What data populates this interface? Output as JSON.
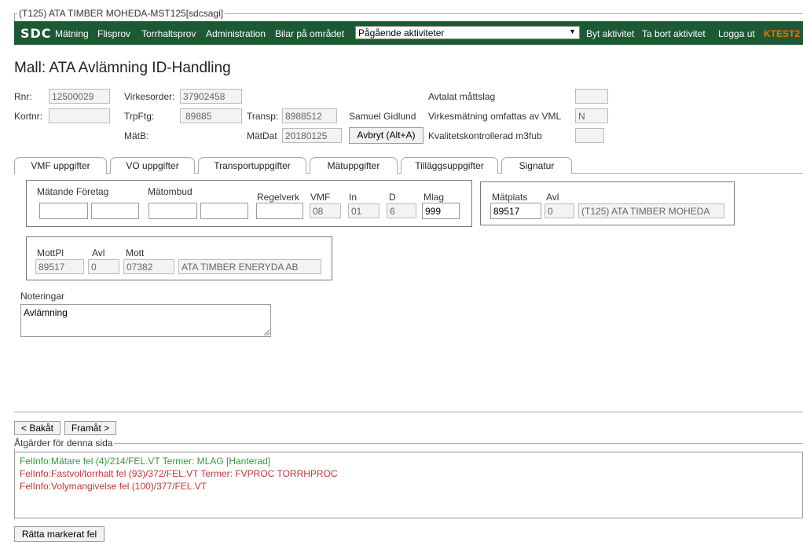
{
  "window": {
    "title": "(T125) ATA TIMBER MOHEDA-MST125[sdcsagi]"
  },
  "menu": {
    "logo": "SDC",
    "items": [
      "Mätning",
      "Flisprov",
      "Torrhaltsprov",
      "Administration",
      "Bilar på området"
    ],
    "activity_select": "Pågående aktiviteter",
    "actions": [
      "Byt aktivitet",
      "Ta bort aktivitet",
      "Logga ut"
    ],
    "env": "KTEST2",
    "env_color": "#ff6a00",
    "bar_color": "#1d5a33"
  },
  "page_title": "Mall: ATA Avlämning ID-Handling",
  "header": {
    "rnr_label": "Rnr:",
    "rnr": "12500029",
    "kortnr_label": "Kortnr:",
    "kortnr": "",
    "virkesorder_label": "Virkesorder:",
    "virkesorder": "37902458",
    "trpftg_label": "TrpFtg:",
    "trpftg": "89885",
    "matb_label": "MätB:",
    "transp_label": "Transp:",
    "transp": "8988512",
    "transp_name": "Samuel Gidlund",
    "matdat_label": "MätDat",
    "matdat": "20180125",
    "avbryt_button": "Avbryt (Alt+A)",
    "avtalat_label": "Avtalat måttslag",
    "avtalat": "",
    "vml_label": "Virkesmätning omfattas av VML",
    "vml": "N",
    "kvalitet_label": "Kvalitetskontrollerad m3fub",
    "kvalitet": ""
  },
  "tabs": [
    "VMF uppgifter",
    "VO uppgifter",
    "Transportuppgifter",
    "Mätuppgifter",
    "Tilläggsuppgifter",
    "Signatur"
  ],
  "vmf": {
    "matande_label": "Mätande Företag",
    "matombud_label": "Mätombud",
    "regelverk_label": "Regelverk",
    "vmf_label": "VMF",
    "vmf": "08",
    "in_label": "In",
    "in": "01",
    "d_label": "D",
    "d": "6",
    "mlag_label": "Mlag",
    "mlag": "999"
  },
  "matplats": {
    "label": "Mätplats",
    "value": "89517",
    "avl_label": "Avl",
    "avl": "0",
    "name": "(T125) ATA TIMBER MOHEDA"
  },
  "mottpl": {
    "label": "MottPl",
    "value": "89517",
    "avl_label": "Avl",
    "avl": "0",
    "mott_label": "Mott",
    "mott": "07382",
    "mott_name": "ATA TIMBER ENERYDA AB"
  },
  "notes": {
    "label": "Noteringar",
    "value": "Avlämning"
  },
  "nav": {
    "back": "< Bakåt",
    "forward": "Framåt >"
  },
  "actions_panel": {
    "title": "Åtgärder för denna sida",
    "messages": [
      {
        "text": "FelInfo:Mätare fel (4)/214/FEL.VT Termer: MLAG [Hanterad]",
        "color": "#3a9a3a"
      },
      {
        "text": "FelInfo:Fastvol/torrhalt fel (93)/372/FEL.VT Termer: FVPROC TORRHPROC",
        "color": "#c03838"
      },
      {
        "text": "FelInfo:Volymangivelse fel (100)/377/FEL.VT",
        "color": "#c03838"
      }
    ]
  },
  "fix_button": "Rätta markerat fel"
}
